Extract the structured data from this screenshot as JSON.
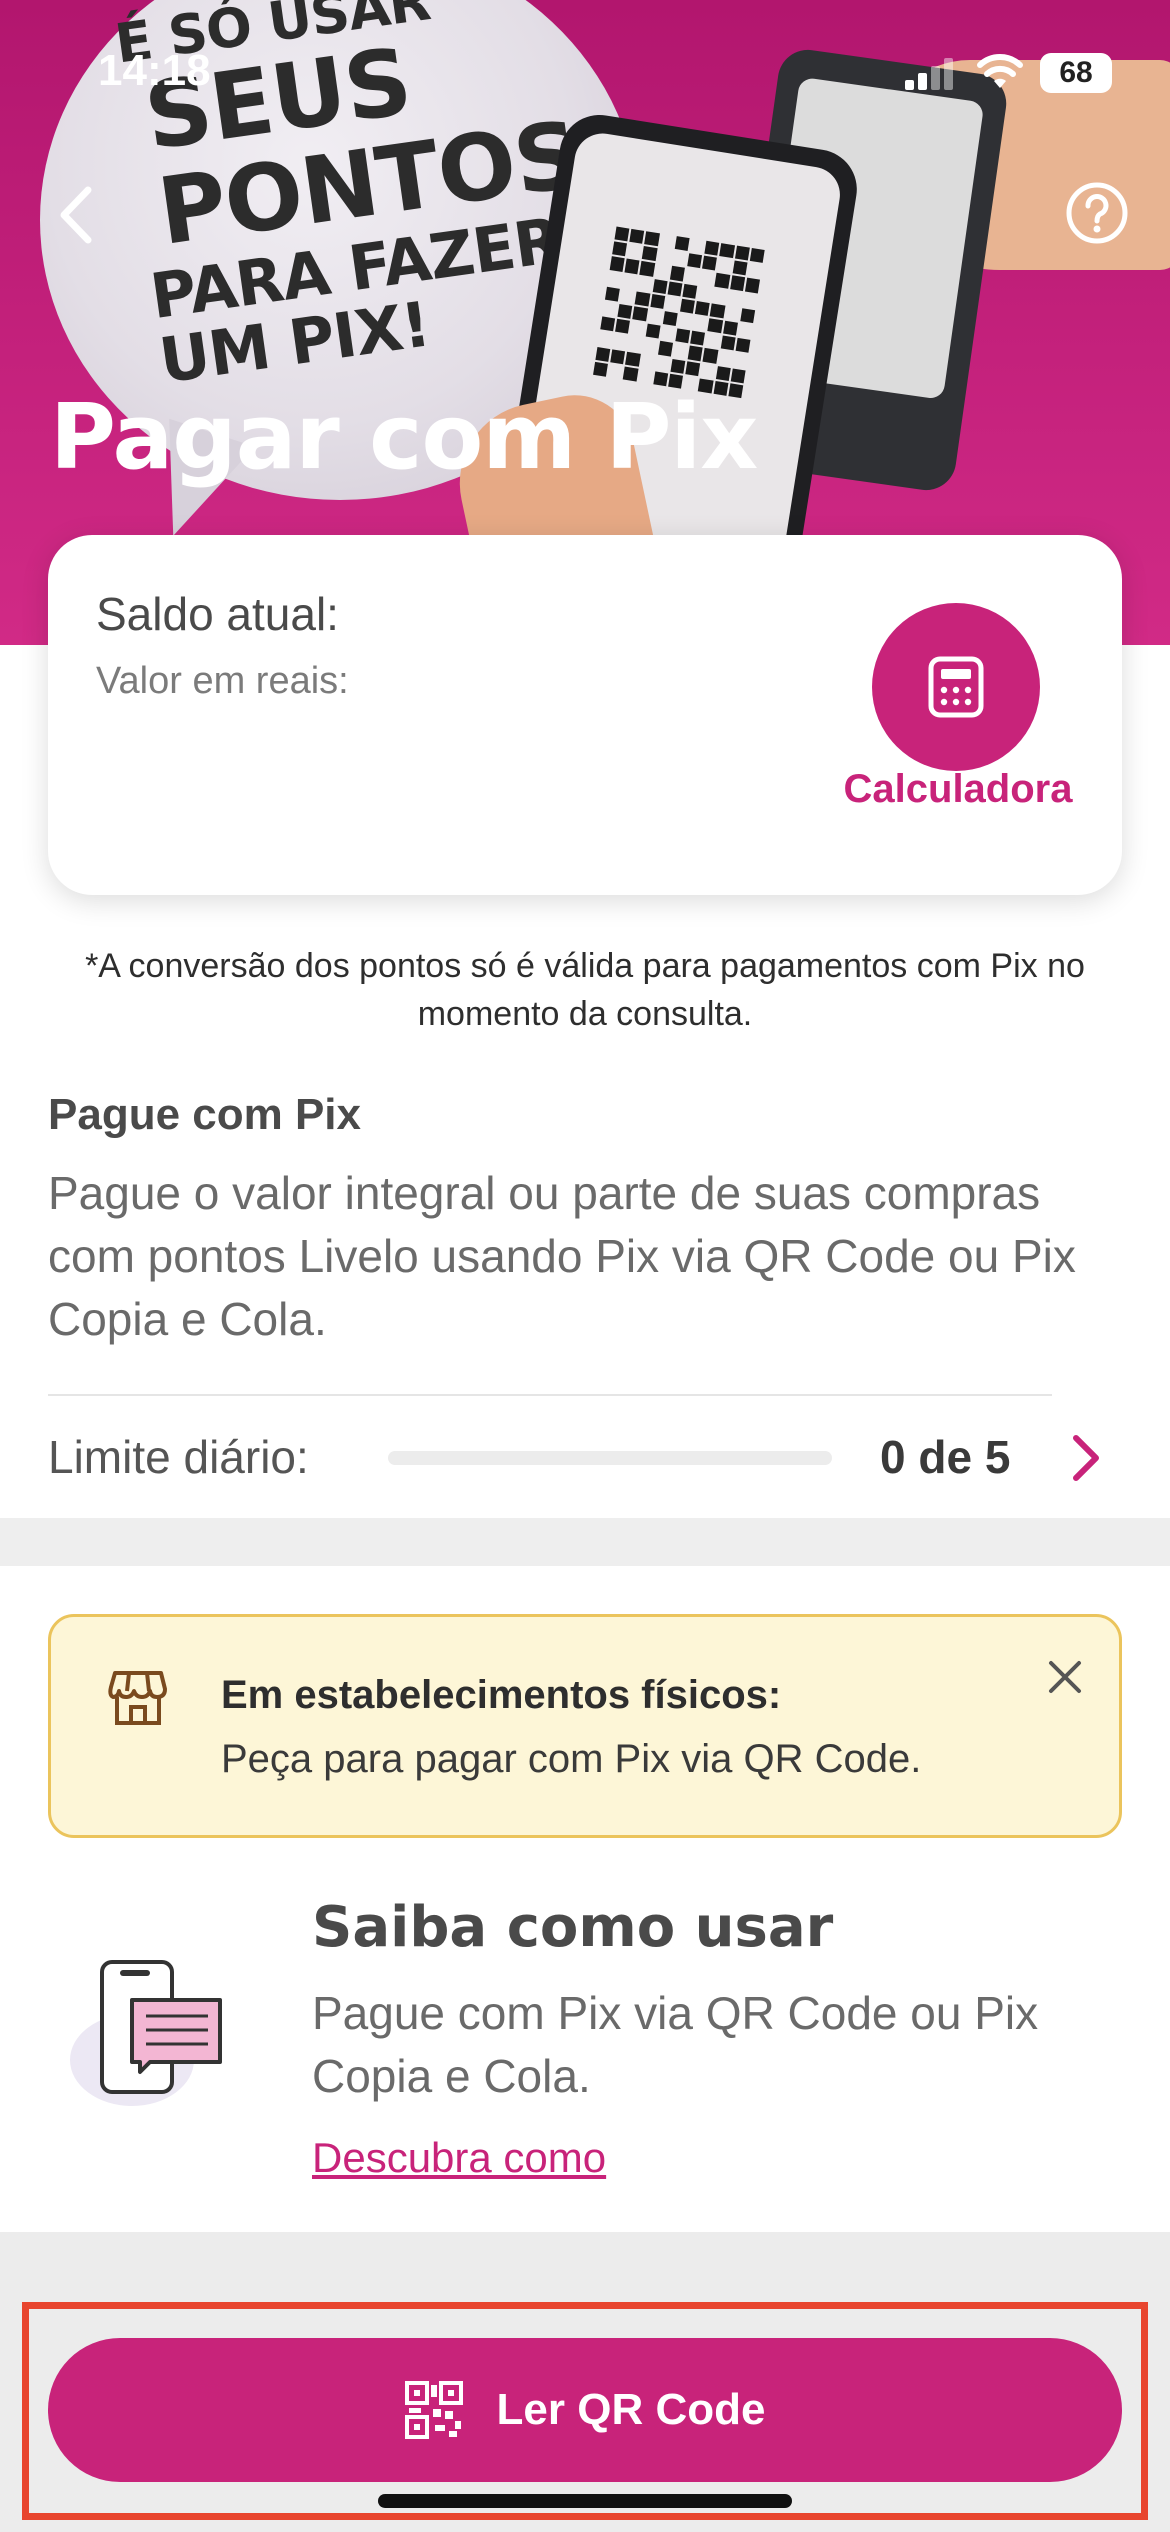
{
  "status_bar": {
    "time": "14:18",
    "battery": "68"
  },
  "hero": {
    "slogan_line1": "É SÓ USAR",
    "slogan_line2": "SEUS PONTOS",
    "slogan_line3": "PARA FAZER UM PIX!",
    "title": "Pagar com Pix"
  },
  "balance_card": {
    "label": "Saldo atual:",
    "sub_label": "Valor em reais:",
    "calculator_label": "Calculadora"
  },
  "disclaimer": "*A conversão dos pontos só é válida para pagamentos com Pix no momento da consulta.",
  "pay_section": {
    "heading": "Pague com Pix",
    "body": "Pague o valor integral ou parte de suas compras com pontos Livelo usando Pix via QR Code ou Pix Copia e Cola.",
    "limit_label": "Limite diário:",
    "limit_value": "0 de 5",
    "limit_used_fraction": 0
  },
  "notice": {
    "title": "Em estabelecimentos físicos:",
    "text": "Peça para pagar com Pix via QR Code."
  },
  "howto": {
    "title": "Saiba como usar",
    "body": "Pague com Pix via QR Code ou Pix Copia e Cola.",
    "link": "Descubra como"
  },
  "cta": {
    "label": "Ler QR Code"
  },
  "colors": {
    "brand": "#c8237a",
    "notice_bg": "#fdf6d7",
    "notice_border": "#ebc45c",
    "highlight_outline": "#e8452e"
  },
  "icons": {
    "back": "chevron-left-icon",
    "help": "question-circle-icon",
    "calculator": "calculator-icon",
    "limit_detail": "chevron-right-icon",
    "store": "store-icon",
    "close": "close-icon",
    "qr": "qr-code-icon"
  }
}
